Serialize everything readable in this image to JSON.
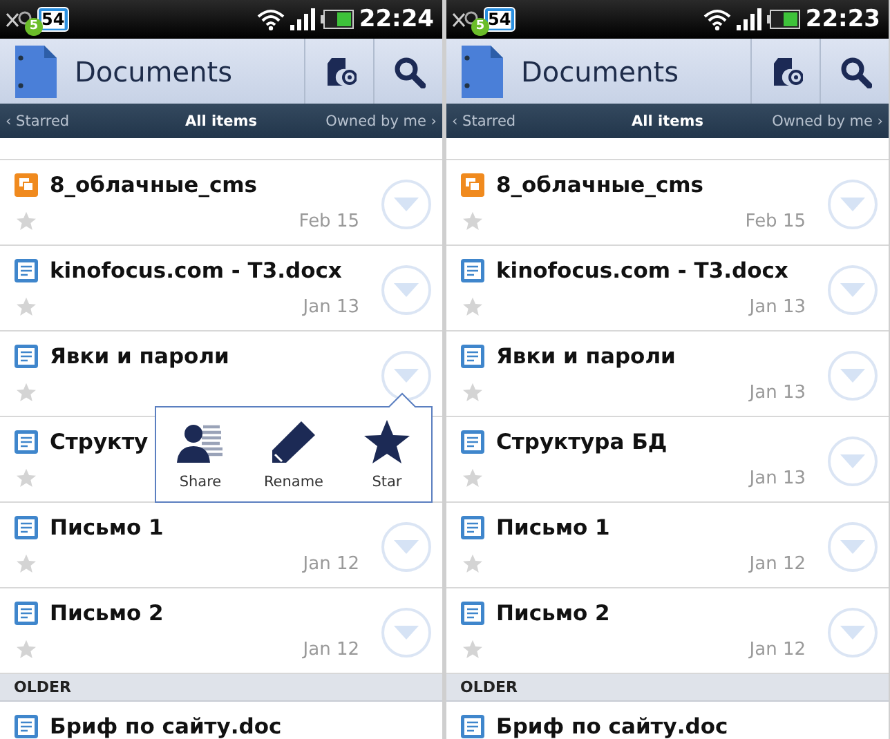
{
  "screens": [
    {
      "status_bar": {
        "notification_count": "5",
        "message_count": "54",
        "time": "22:24"
      },
      "title": "Documents",
      "tabs": [
        {
          "label": "‹ Starred",
          "selected": false
        },
        {
          "label": "All items",
          "selected": true
        },
        {
          "label": "Owned by me ›",
          "selected": false
        }
      ],
      "documents": [
        {
          "kind": "presentation",
          "title": "8_облачные_cms",
          "date": "Feb 15",
          "starred": false
        },
        {
          "kind": "document",
          "title": "kinofocus.com - T3.docx",
          "date": "Jan 13",
          "starred": false
        },
        {
          "kind": "document",
          "title": "Явки и пароли",
          "starred": false,
          "menu": [
            {
              "kind": "share",
              "label": "Share"
            },
            {
              "kind": "rename",
              "label": "Rename"
            },
            {
              "kind": "star",
              "label": "Star"
            }
          ]
        },
        {
          "kind": "document",
          "title": "Структу",
          "starred": false
        },
        {
          "kind": "document",
          "title": "Письмо 1",
          "date": "Jan 12",
          "starred": false
        },
        {
          "kind": "document",
          "title": "Письмо 2",
          "date": "Jan 12",
          "starred": false
        }
      ],
      "section": "OLDER",
      "older_documents": [
        {
          "kind": "document",
          "title": "Бриф по сайту.doc"
        }
      ]
    },
    {
      "status_bar": {
        "notification_count": "5",
        "message_count": "54",
        "time": "22:23"
      },
      "title": "Documents",
      "tabs": [
        {
          "label": "‹ Starred",
          "selected": false
        },
        {
          "label": "All items",
          "selected": true
        },
        {
          "label": "Owned by me ›",
          "selected": false
        }
      ],
      "documents": [
        {
          "kind": "presentation",
          "title": "8_облачные_cms",
          "date": "Feb 15",
          "starred": false
        },
        {
          "kind": "document",
          "title": "kinofocus.com - T3.docx",
          "date": "Jan 13",
          "starred": false
        },
        {
          "kind": "document",
          "title": "Явки и пароли",
          "date": "Jan 13",
          "starred": false
        },
        {
          "kind": "document",
          "title": "Структура БД",
          "date": "Jan 13",
          "starred": false
        },
        {
          "kind": "document",
          "title": "Письмо 1",
          "date": "Jan 12",
          "starred": false
        },
        {
          "kind": "document",
          "title": "Письмо 2",
          "date": "Jan 12",
          "starred": false
        }
      ],
      "section": "OLDER",
      "older_documents": [
        {
          "kind": "document",
          "title": "Бриф по сайту.doc"
        }
      ]
    }
  ]
}
